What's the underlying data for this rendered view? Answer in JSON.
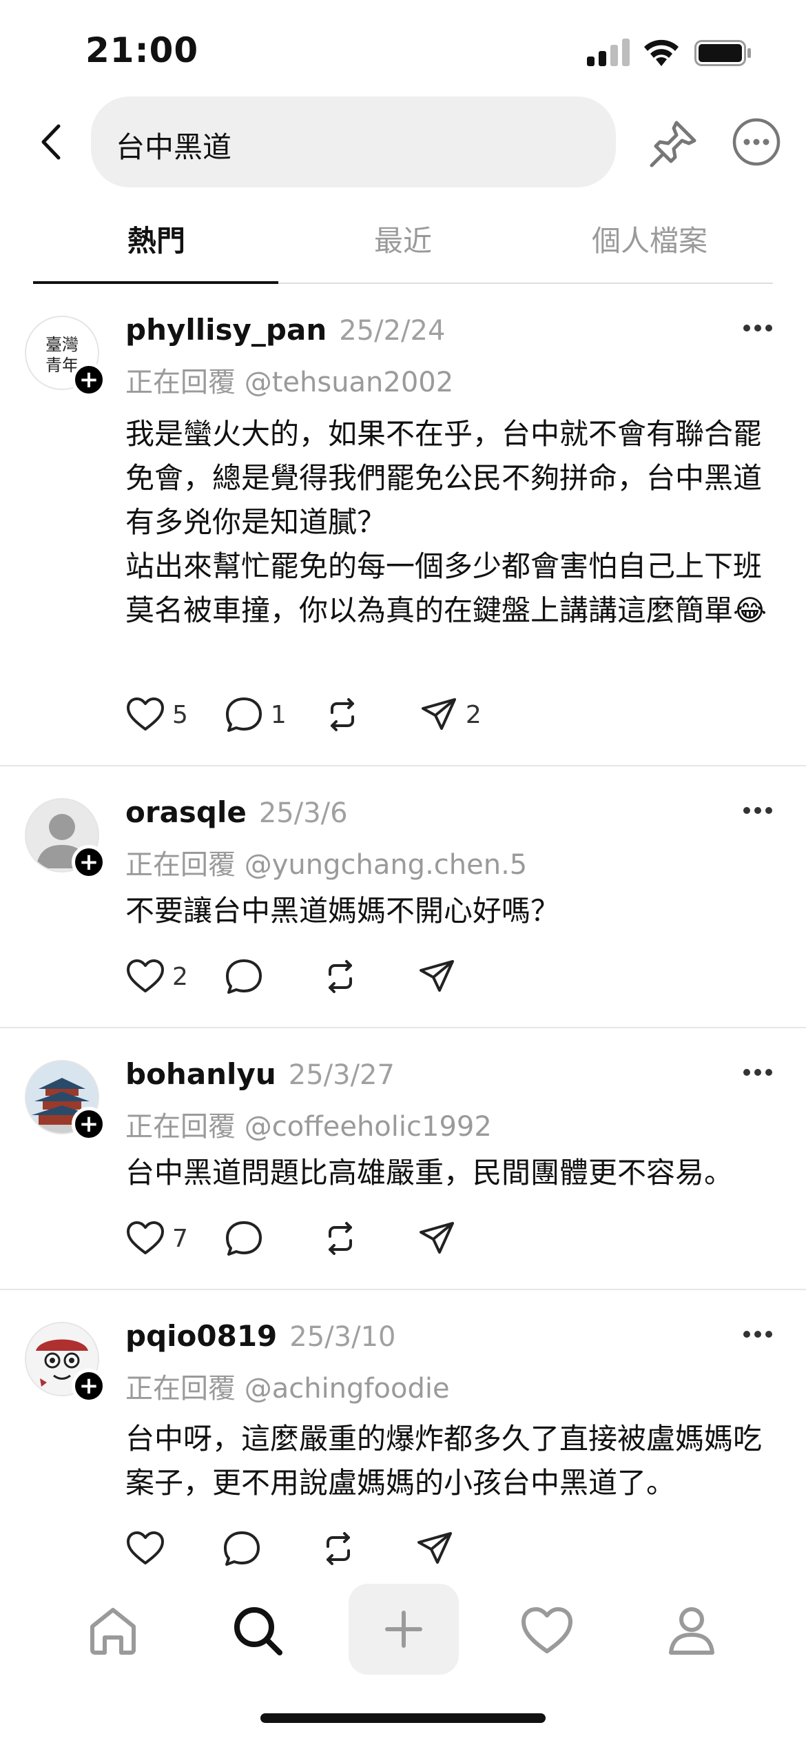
{
  "status": {
    "time": "21:00"
  },
  "search": {
    "query": "台中黑道"
  },
  "tabs": [
    {
      "label": "熱門"
    },
    {
      "label": "最近"
    },
    {
      "label": "個人檔案"
    }
  ],
  "posts": [
    {
      "username": "phyllisy_pan",
      "date": "25/2/24",
      "reply_to": "正在回覆 @tehsuan2002",
      "body": "我是蠻火大的，如果不在乎，台中就不會有聯合罷免會，總是覺得我們罷免公民不夠拼命，台中黑道有多兇你是知道膩？\n站出來幫忙罷免的每一個多少都會害怕自己上下班莫名被車撞，你以為真的在鍵盤上講講這麼簡單😂",
      "likes": "5",
      "replies": "1",
      "reposts": "",
      "shares": "2"
    },
    {
      "username": "orasqle",
      "date": "25/3/6",
      "reply_to": "正在回覆 @yungchang.chen.5",
      "body": "不要讓台中黑道媽媽不開心好嗎？",
      "likes": "2",
      "replies": "",
      "reposts": "",
      "shares": ""
    },
    {
      "username": "bohanlyu",
      "date": "25/3/27",
      "reply_to": "正在回覆 @coffeeholic1992",
      "body": "台中黑道問題比高雄嚴重，民間團體更不容易。",
      "likes": "7",
      "replies": "",
      "reposts": "",
      "shares": ""
    },
    {
      "username": "pqio0819",
      "date": "25/3/10",
      "reply_to": "正在回覆 @achingfoodie",
      "body": "台中呀，這麼嚴重的爆炸都多久了直接被盧媽媽吃案子，更不用說盧媽媽的小孩台中黑道了。",
      "likes": "",
      "replies": "",
      "reposts": "",
      "shares": ""
    }
  ],
  "avatar_text": "臺灣青年"
}
